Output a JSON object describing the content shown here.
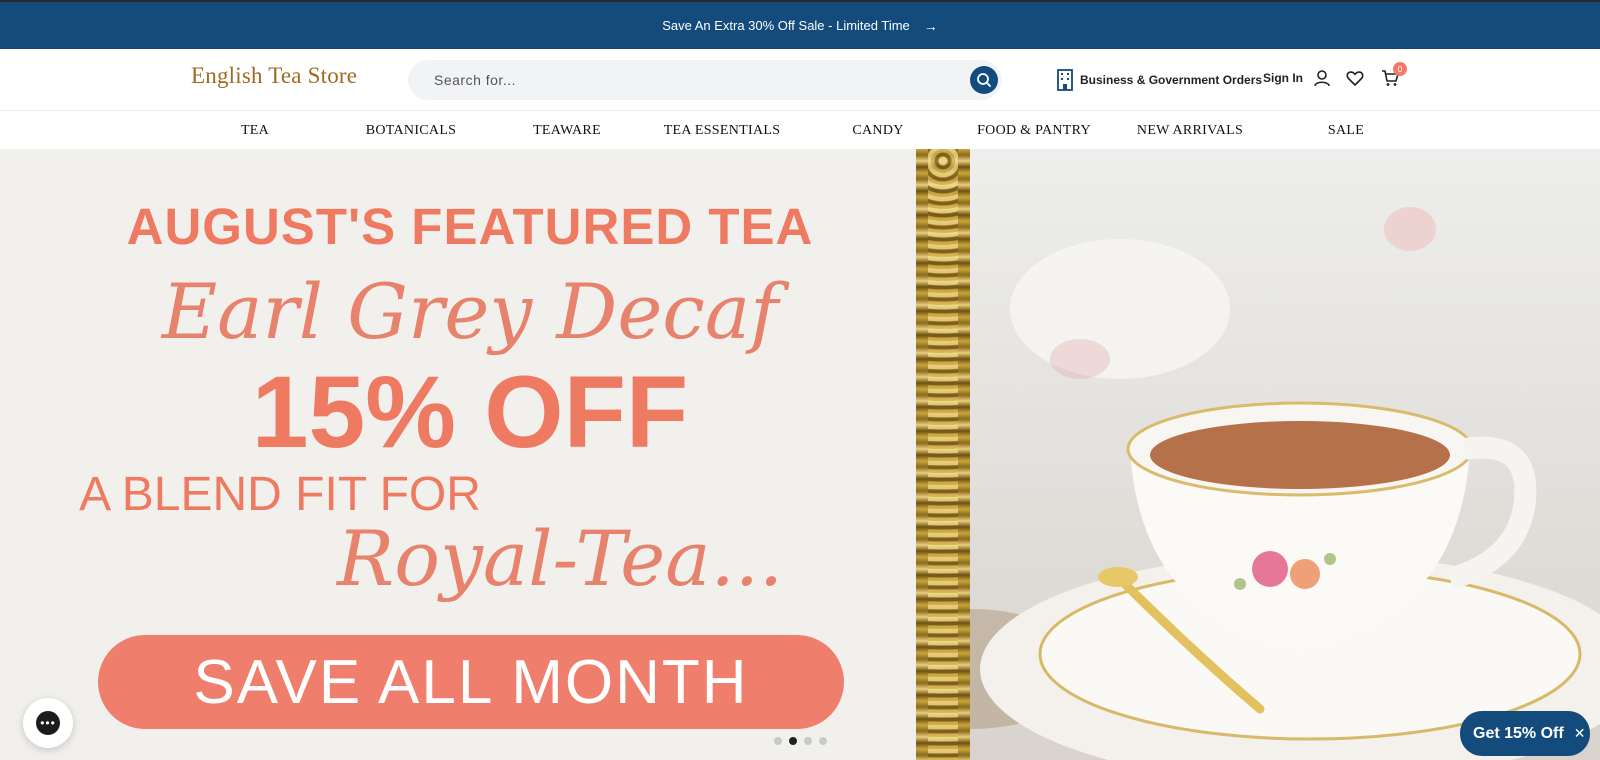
{
  "announcement": {
    "text": "Save An Extra 30% Off Sale - Limited Time",
    "arrow": "→"
  },
  "header": {
    "logo": "English Tea Store",
    "search_placeholder": "Search for...",
    "business_orders": "Business & Government Orders",
    "sign_in": "Sign In",
    "cart_count": "0"
  },
  "nav": {
    "items": [
      "TEA",
      "BOTANICALS",
      "TEAWARE",
      "TEA ESSENTIALS",
      "CANDY",
      "FOOD & PANTRY",
      "NEW ARRIVALS",
      "SALE"
    ]
  },
  "hero": {
    "featured": "AUGUST'S FEATURED TEA",
    "tea_name": "Earl Grey Decaf",
    "discount": "15% OFF",
    "blend_line": "A BLEND FIT FOR",
    "royal_line": "Royal-Tea...",
    "cta": "SAVE ALL MONTH",
    "slides_total": 4,
    "active_slide": 2
  },
  "promo": {
    "label": "Get 15% Off",
    "close": "✕"
  },
  "chat": {
    "icon": "chat-bubble-icon"
  },
  "colors": {
    "brand_blue": "#134b7d",
    "coral": "#ee7a62",
    "gold": "#a06a20"
  }
}
